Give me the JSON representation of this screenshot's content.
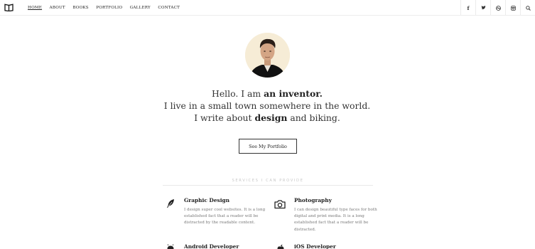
{
  "nav": {
    "items": [
      {
        "label": "HOME",
        "active": true
      },
      {
        "label": "ABOUT"
      },
      {
        "label": "BOOKS"
      },
      {
        "label": "PORTFOLIO"
      },
      {
        "label": "GALLERY"
      },
      {
        "label": "CONTACT"
      }
    ],
    "social": [
      "facebook-icon",
      "twitter-icon",
      "dribbble-icon",
      "instagram-icon",
      "search-icon"
    ]
  },
  "hero": {
    "line1_prefix": "Hello. I am ",
    "line1_bold": "an inventor.",
    "line2": "I live in a small town somewhere in the world.",
    "line3_prefix": "I write about ",
    "line3_bold": "design",
    "line3_suffix": " and biking.",
    "button_label": "See My Portfolio"
  },
  "services": {
    "title": "Services I can provide",
    "items": [
      {
        "icon": "feather-icon",
        "title": "Graphic Design",
        "text": "I design super cool websites. It is a long established fact that a reader will be distracted by the readable content."
      },
      {
        "icon": "camera-icon",
        "title": "Photography",
        "text": "I can design beautiful type faces for both digital and print media. It is a long established fact that a reader will be distracted."
      },
      {
        "icon": "android-icon",
        "title": "Android Developer",
        "text": ""
      },
      {
        "icon": "apple-icon",
        "title": "iOS Developer",
        "text": ""
      }
    ]
  },
  "colors": {
    "text": "#333333",
    "muted": "#7a7a7a",
    "divider": "#ececec",
    "avatar_bg": "#f6ecd6"
  }
}
